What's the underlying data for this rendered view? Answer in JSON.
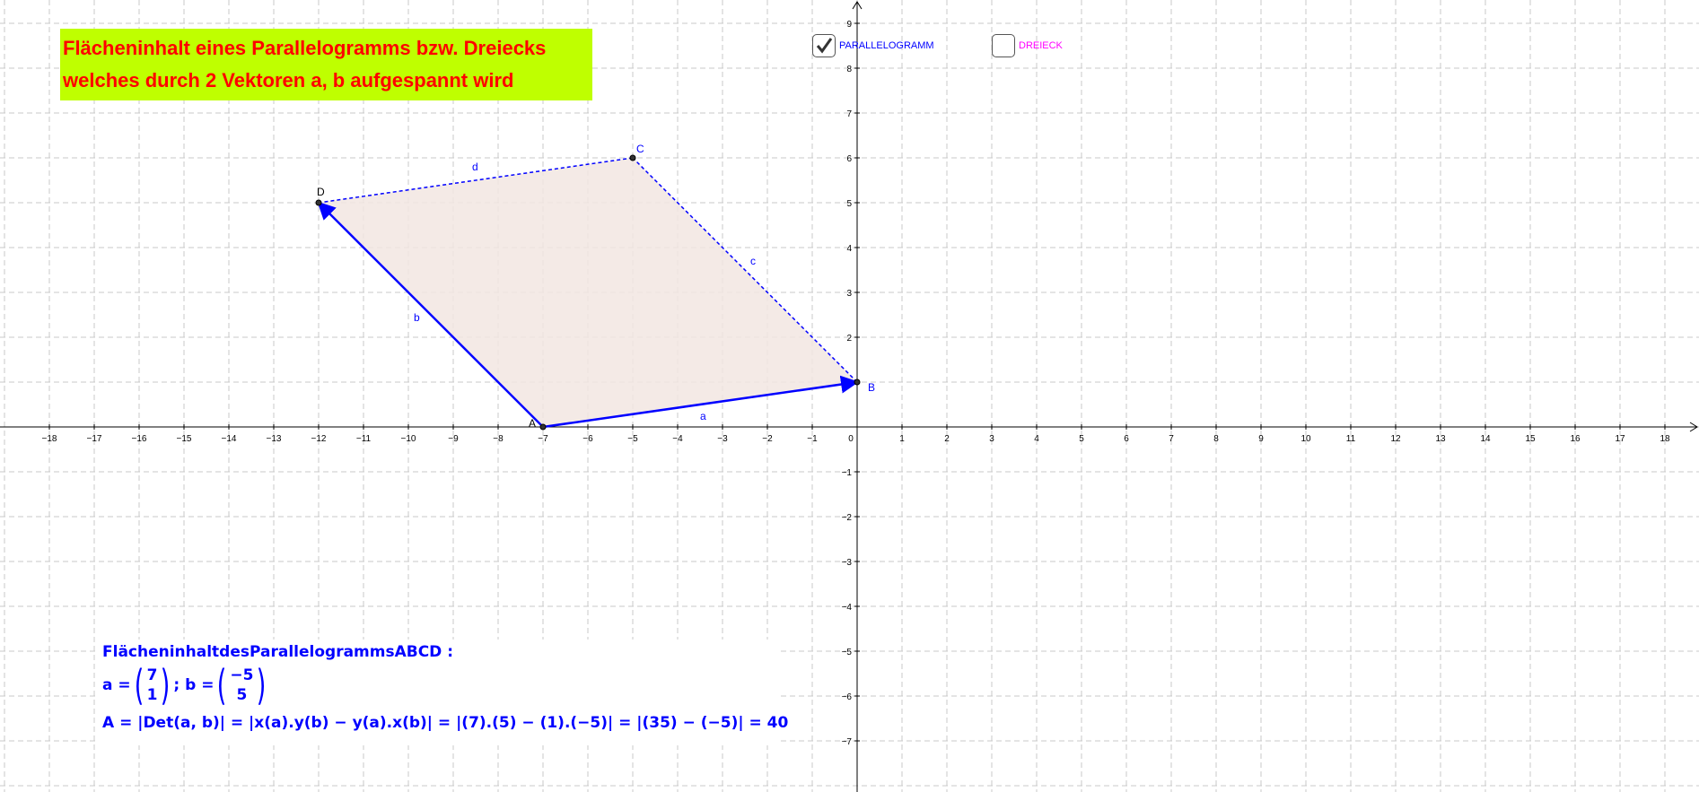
{
  "title": {
    "line1": "Flächeninhalt eines Parallelogramms bzw. Dreiecks",
    "line2": "welches durch 2 Vektoren a, b aufgespannt wird"
  },
  "checkboxes": {
    "parallelogramm": {
      "label": "PARALLELOGRAMM",
      "checked": true,
      "color": "#0000ff"
    },
    "dreieck": {
      "label": "DREIECK",
      "checked": false,
      "color": "#ff00ff"
    }
  },
  "axes": {
    "x_range": [
      -18,
      18
    ],
    "y_range": [
      -7,
      9
    ],
    "x_ticks": [
      "−18",
      "−17",
      "−16",
      "−15",
      "−14",
      "−13",
      "−12",
      "−11",
      "−10",
      "−9",
      "−8",
      "−7",
      "−6",
      "−5",
      "−4",
      "−3",
      "−2",
      "−1",
      "0",
      "1",
      "2",
      "3",
      "4",
      "5",
      "6",
      "7",
      "8",
      "9",
      "10",
      "11",
      "12",
      "13",
      "14",
      "15",
      "16",
      "17",
      "18"
    ],
    "y_ticks": [
      "9",
      "8",
      "7",
      "6",
      "5",
      "4",
      "3",
      "2",
      "1",
      "−1",
      "−2",
      "−3",
      "−4",
      "−5",
      "−6",
      "−7"
    ],
    "grid": true
  },
  "points": {
    "A": {
      "label": "A",
      "x": -7,
      "y": 0
    },
    "B": {
      "label": "B",
      "x": 0,
      "y": 1
    },
    "C": {
      "label": "C",
      "x": -5,
      "y": 6
    },
    "D": {
      "label": "D",
      "x": -12,
      "y": 5
    }
  },
  "segments": {
    "a": {
      "label": "a"
    },
    "b": {
      "label": "b"
    },
    "c": {
      "label": "c"
    },
    "d": {
      "label": "d"
    }
  },
  "colors": {
    "vector": "#0000ff",
    "fill": "#f2e6e2",
    "title_bg": "#bfff00",
    "title_text": "#ff0000",
    "grid": "#c8c8c8"
  },
  "formula": {
    "heading": "FlächeninhaltdesParallelogrammsABCD :",
    "a_prefix": "a =",
    "a_x": "7",
    "a_y": "1",
    "sep": "; b =",
    "b_x": "−5",
    "b_y": "5",
    "area": "A = |Det(a, b)| = |x(a).y(b) − y(a).x(b)| = |(7).(5) − (1).(−5)| = |(35) − (−5)| = 40"
  }
}
